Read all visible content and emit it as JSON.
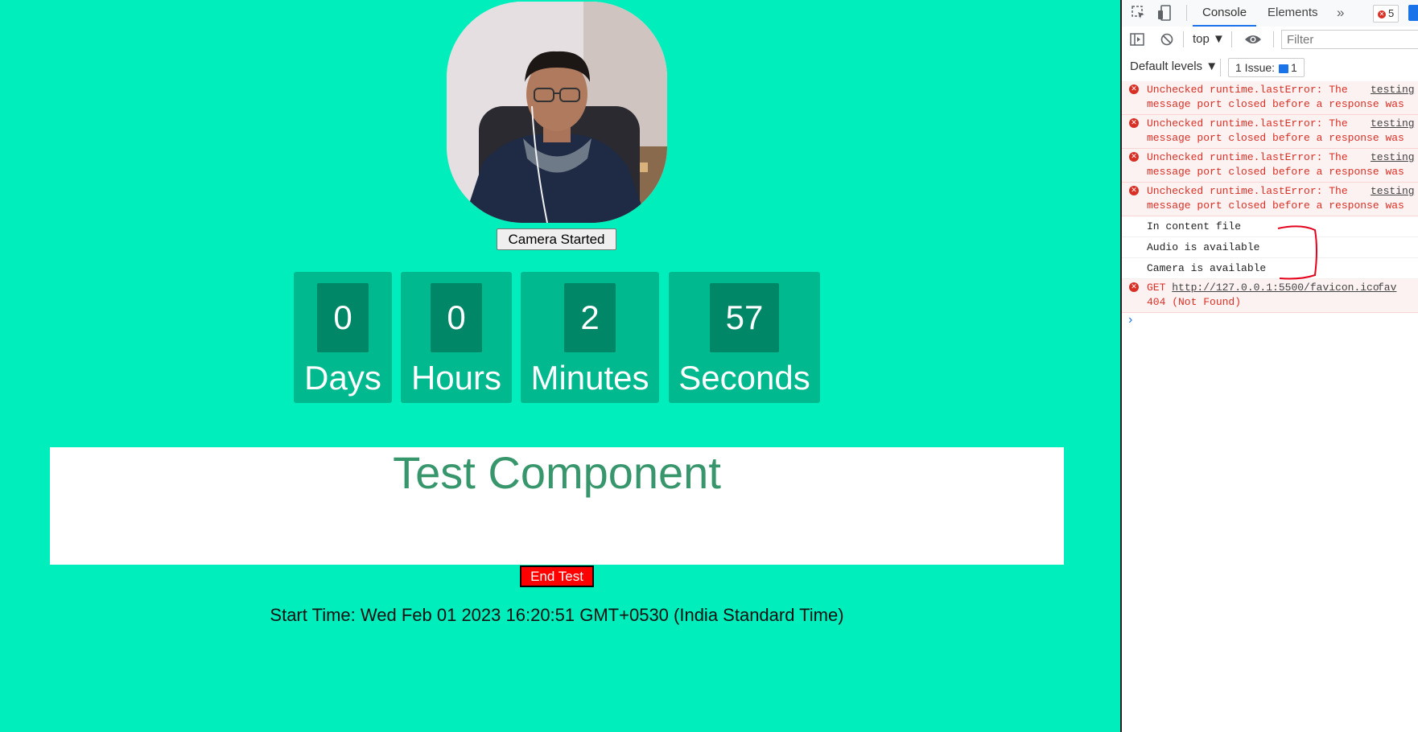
{
  "page": {
    "camera_button": "Camera Started",
    "timer": [
      {
        "value": "0",
        "label": "Days"
      },
      {
        "value": "0",
        "label": "Hours"
      },
      {
        "value": "2",
        "label": "Minutes"
      },
      {
        "value": "57",
        "label": "Seconds"
      }
    ],
    "test_title": "Test Component",
    "end_button": "End Test",
    "start_time_label": "Start Time:",
    "start_time_value": "Wed Feb 01 2023 16:20:51 GMT+0530 (India Standard Time)"
  },
  "devtools": {
    "tabs": [
      "Console",
      "Elements"
    ],
    "error_count": "5",
    "context": "top",
    "filter_placeholder": "Filter",
    "levels": "Default levels",
    "issues_label": "1 Issue:",
    "issues_count": "1",
    "messages": [
      {
        "type": "error",
        "line1": "Unchecked runtime.lastError: The",
        "line2": "message port closed before a response was",
        "source": "testing"
      },
      {
        "type": "error",
        "line1": "Unchecked runtime.lastError: The",
        "line2": "message port closed before a response was",
        "source": "testing"
      },
      {
        "type": "error",
        "line1": "Unchecked runtime.lastError: The",
        "line2": "message port closed before a response was",
        "source": "testing"
      },
      {
        "type": "error",
        "line1": "Unchecked runtime.lastError: The",
        "line2": "message port closed before a response was",
        "source": "testing"
      },
      {
        "type": "log",
        "text": "In content file"
      },
      {
        "type": "log",
        "text": "Audio is available"
      },
      {
        "type": "log",
        "text": "Camera is available"
      },
      {
        "type": "error",
        "method": "GET",
        "url": "http://127.0.0.1:5500/favicon.ico",
        "line2": "404 (Not Found)",
        "source": "fav"
      }
    ]
  },
  "colors": {
    "page_background": "#00eebb",
    "timer_box": "#00b98e",
    "timer_number_box": "#008767",
    "test_title": "#37966b",
    "end_button": "#ff0000",
    "devtools_accent": "#1a73e8",
    "error_text": "#d93025"
  },
  "icons": [
    "inspect-icon",
    "device-toggle-icon",
    "chevrons-right-icon",
    "sidebar-icon",
    "clear-icon",
    "eye-icon",
    "error-icon",
    "chat-icon",
    "prompt-chevron-icon"
  ]
}
